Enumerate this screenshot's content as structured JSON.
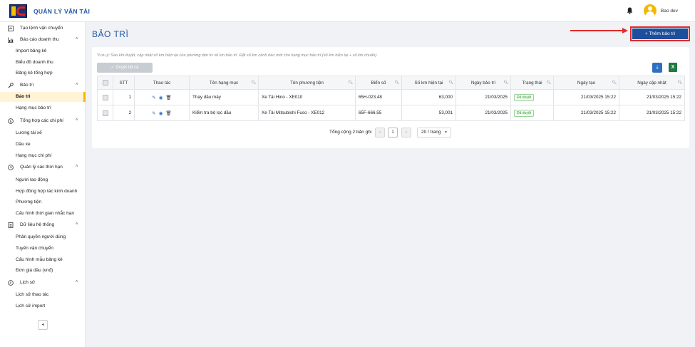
{
  "header": {
    "app_title": "QUẢN LÝ VẬN TẢI",
    "username": "Bao dev",
    "icons": [
      "logo",
      "bell-icon",
      "avatar"
    ]
  },
  "sidebar": {
    "items": [
      {
        "type": "group",
        "label": "Tạo lệnh vận chuyển",
        "icon": "truck-order-icon",
        "chevron": ""
      },
      {
        "type": "group",
        "label": "Báo cáo doanh thu",
        "icon": "bar-chart-icon",
        "chevron": "^"
      },
      {
        "type": "child",
        "label": "Import bảng kê"
      },
      {
        "type": "child",
        "label": "Biểu đồ doanh thu"
      },
      {
        "type": "child",
        "label": "Bảng kê tổng hợp"
      },
      {
        "type": "group",
        "label": "Bảo trì",
        "icon": "wrench-icon",
        "chevron": "^"
      },
      {
        "type": "child",
        "label": "Bảo trì",
        "active": true
      },
      {
        "type": "child",
        "label": "Hạng mục bảo trì"
      },
      {
        "type": "group",
        "label": "Tổng hợp các chi phí",
        "icon": "money-icon",
        "chevron": "^"
      },
      {
        "type": "child",
        "label": "Lương tài xế"
      },
      {
        "type": "child",
        "label": "Dầu xe"
      },
      {
        "type": "child",
        "label": "Hạng mục chi phí"
      },
      {
        "type": "group",
        "label": "Quản lý các thời hạn",
        "icon": "clock-icon",
        "chevron": "^"
      },
      {
        "type": "child",
        "label": "Người lao động"
      },
      {
        "type": "child",
        "label": "Hợp đồng hợp tác kinh doanh"
      },
      {
        "type": "child",
        "label": "Phương tiện"
      },
      {
        "type": "child",
        "label": "Cấu hình thời gian nhắc hạn"
      },
      {
        "type": "group",
        "label": "Dữ liệu hệ thống",
        "icon": "database-icon",
        "chevron": "^"
      },
      {
        "type": "child",
        "label": "Phân quyền người dùng"
      },
      {
        "type": "child",
        "label": "Tuyến vận chuyển"
      },
      {
        "type": "child",
        "label": "Cấu hình mẫu bảng kê"
      },
      {
        "type": "child",
        "label": "Đơn giá dầu (vnđ)"
      },
      {
        "type": "group",
        "label": "Lịch sử",
        "icon": "history-icon",
        "chevron": "^"
      },
      {
        "type": "child",
        "label": "Lịch sử thao tác"
      },
      {
        "type": "child",
        "label": "Lịch sử import"
      }
    ],
    "collapse_label": "◂"
  },
  "main": {
    "title": "BẢO TRÌ",
    "add_button": "+ Thêm bảo trì",
    "note": "*Lưu ý: Sau khi duyệt, cập nhật số km hiện tại của phương tiện từ số km bảo trì. Đặt số km cảnh báo mới cho hạng mục bảo trì (số km hiện tại + số km chuẩn).",
    "approve_all": "✓  Duyệt tất cả",
    "table": {
      "columns": [
        "",
        "STT",
        "Thao tác",
        "Tên hạng mục",
        "Tên phương tiện",
        "Biển số",
        "Số km hiện tại",
        "Ngày bảo trì",
        "Trạng thái",
        "Ngày tạo",
        "Ngày cập nhật"
      ],
      "rows": [
        {
          "stt": "1",
          "item": "Thay dầu máy",
          "vehicle": "Xe Tải Hino - XE010",
          "plate": "65H-023.48",
          "km": "63,000",
          "maintenance_date": "21/03/2025",
          "status": "Đã duyệt",
          "created": "21/03/2025 15:22",
          "updated": "21/03/2025 15:22"
        },
        {
          "stt": "2",
          "item": "Kiểm tra bộ lọc dầu",
          "vehicle": "Xe Tải Mitsubishi Fuso - XE012",
          "plate": "65F-666.55",
          "km": "53,001",
          "maintenance_date": "21/03/2025",
          "status": "Đã duyệt",
          "created": "21/03/2025 15:22",
          "updated": "21/03/2025 15:22"
        }
      ]
    },
    "pagination": {
      "total": "Tổng cộng 2 bản ghi",
      "current_page": "1",
      "page_size": "20 / trang"
    }
  }
}
